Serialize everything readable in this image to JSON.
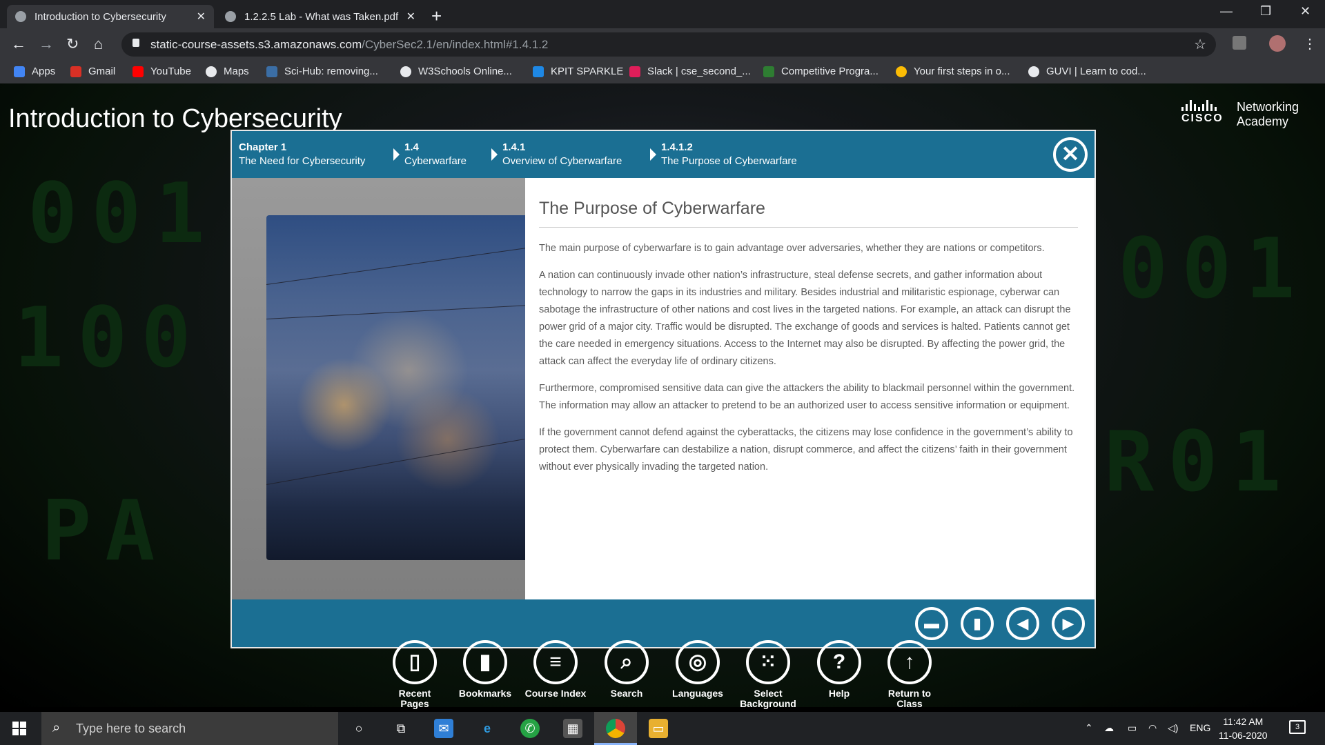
{
  "browser": {
    "tabs": [
      {
        "title": "Introduction to Cybersecurity",
        "active": true
      },
      {
        "title": "1.2.2.5 Lab - What was Taken.pdf",
        "active": false
      }
    ],
    "url_domain": "static-course-assets.s3.amazonaws.com",
    "url_path": "/CyberSec2.1/en/index.html#1.4.1.2",
    "bookmarks": [
      {
        "label": "Apps",
        "color": "#4285f4"
      },
      {
        "label": "Gmail",
        "color": "#d93025"
      },
      {
        "label": "YouTube",
        "color": "#ff0000"
      },
      {
        "label": "Maps",
        "color": "#e8eaed"
      },
      {
        "label": "Sci-Hub: removing...",
        "color": "#3b6ea5"
      },
      {
        "label": "W3Schools Online...",
        "color": "#e8eaed"
      },
      {
        "label": "KPIT SPARKLE",
        "color": "#1e88e5"
      },
      {
        "label": "Slack | cse_second_...",
        "color": "#e01e5a"
      },
      {
        "label": "Competitive Progra...",
        "color": "#2e7d32"
      },
      {
        "label": "Your first steps in o...",
        "color": "#fbbc05"
      },
      {
        "label": "GUVI | Learn to cod...",
        "color": "#e8eaed"
      }
    ]
  },
  "course": {
    "title": "Introduction to Cybersecurity",
    "logo": {
      "line1": "Networking",
      "line2": "Academy",
      "brand": "CISCO"
    }
  },
  "breadcrumb": [
    {
      "num": "Chapter 1",
      "label": "The Need for Cybersecurity"
    },
    {
      "num": "1.4",
      "label": "Cyberwarfare"
    },
    {
      "num": "1.4.1",
      "label": "Overview of Cyberwarfare"
    },
    {
      "num": "1.4.1.2",
      "label": "The Purpose of Cyberwarfare"
    }
  ],
  "content": {
    "heading": "The Purpose of Cyberwarfare",
    "paragraphs": [
      "The main purpose of cyberwarfare is to gain advantage over adversaries, whether they are nations or competitors.",
      "A nation can continuously invade other nation’s infrastructure, steal defense secrets, and gather information about technology to narrow the gaps in its industries and military. Besides industrial and militaristic espionage, cyberwar can sabotage the infrastructure of other nations and cost lives in the targeted nations. For example, an attack can disrupt the power grid of a major city. Traffic would be disrupted. The exchange of goods and services is halted. Patients cannot get the care needed in emergency situations. Access to the Internet may also be disrupted. By affecting the power grid, the attack can affect the everyday life of ordinary citizens.",
      "Furthermore, compromised sensitive data can give the attackers the ability to blackmail personnel within the government. The information may allow an attacker to pretend to be an authorized user to access sensitive information or equipment.",
      "If the government cannot defend against the cyberattacks, the citizens may lose confidence in the government’s ability to protect them. Cyberwarfare can destabilize a nation, disrupt commerce, and affect the citizens’ faith in their government without ever physically invading the targeted nation."
    ]
  },
  "bottom_nav": [
    {
      "label": "Recent Pages",
      "icon": "recent-pages-icon"
    },
    {
      "label": "Bookmarks",
      "icon": "bookmark-icon"
    },
    {
      "label": "Course Index",
      "icon": "list-icon"
    },
    {
      "label": "Search",
      "icon": "search-icon"
    },
    {
      "label": "Languages",
      "icon": "globe-icon"
    },
    {
      "label": "Select Background",
      "icon": "grid-icon"
    },
    {
      "label": "Help",
      "icon": "help-icon"
    },
    {
      "label": "Return to Class",
      "icon": "up-arrow-icon"
    }
  ],
  "taskbar": {
    "search_placeholder": "Type here to search",
    "language": "ENG",
    "time": "11:42 AM",
    "date": "11-06-2020",
    "notifications": "3"
  },
  "colors": {
    "modal_blue": "#1b6f93",
    "accent_dot": "#2a8fc1"
  }
}
